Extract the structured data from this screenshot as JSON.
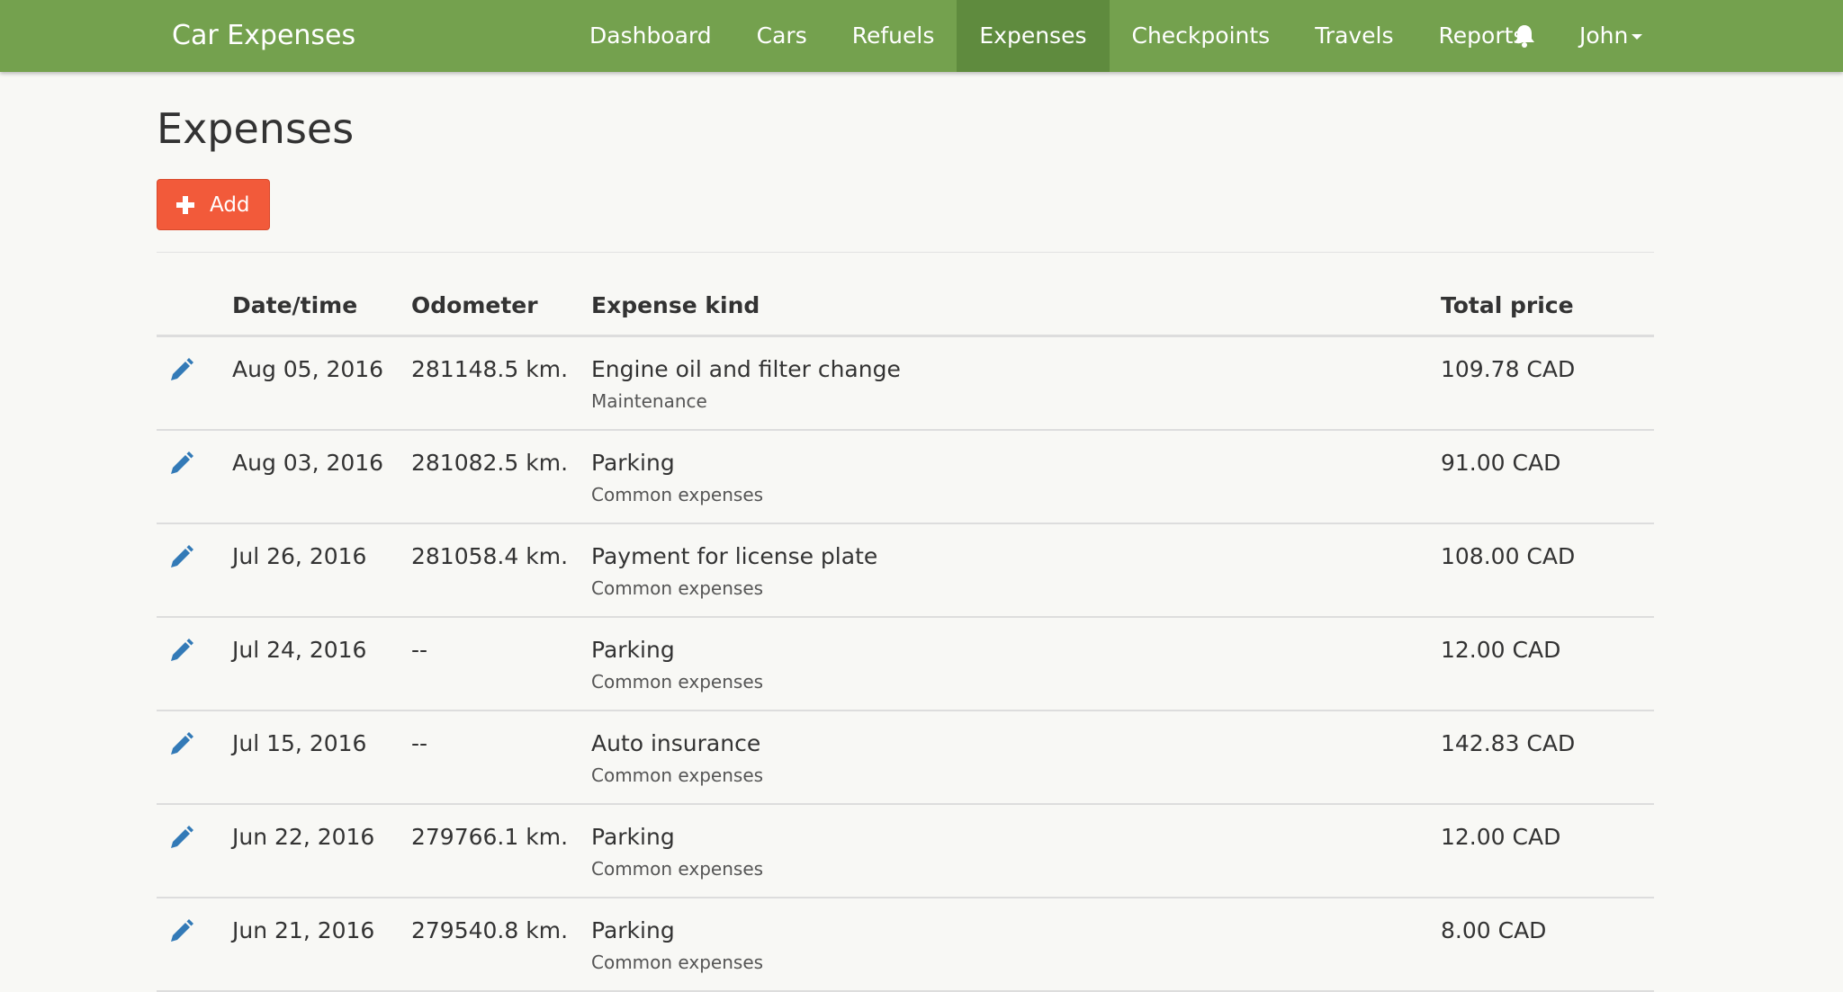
{
  "app": {
    "brand": "Car Expenses"
  },
  "nav": {
    "items": [
      {
        "label": "Dashboard",
        "active": false
      },
      {
        "label": "Cars",
        "active": false
      },
      {
        "label": "Refuels",
        "active": false
      },
      {
        "label": "Expenses",
        "active": true
      },
      {
        "label": "Checkpoints",
        "active": false
      },
      {
        "label": "Travels",
        "active": false
      },
      {
        "label": "Reports",
        "active": false
      }
    ],
    "notifications_icon": "bell-icon",
    "user": "John"
  },
  "page": {
    "title": "Expenses",
    "add_label": "Add"
  },
  "table": {
    "headers": {
      "date": "Date/time",
      "odometer": "Odometer",
      "kind": "Expense kind",
      "total": "Total price"
    },
    "rows": [
      {
        "date": "Aug 05, 2016",
        "odometer": "281148.5 km.",
        "kind": "Engine oil and filter change",
        "category": "Maintenance",
        "total": "109.78 CAD"
      },
      {
        "date": "Aug 03, 2016",
        "odometer": "281082.5 km.",
        "kind": "Parking",
        "category": "Common expenses",
        "total": "91.00 CAD"
      },
      {
        "date": "Jul 26, 2016",
        "odometer": "281058.4 km.",
        "kind": "Payment for license plate",
        "category": "Common expenses",
        "total": "108.00 CAD"
      },
      {
        "date": "Jul 24, 2016",
        "odometer": "--",
        "kind": "Parking",
        "category": "Common expenses",
        "total": "12.00 CAD"
      },
      {
        "date": "Jul 15, 2016",
        "odometer": "--",
        "kind": "Auto insurance",
        "category": "Common expenses",
        "total": "142.83 CAD"
      },
      {
        "date": "Jun 22, 2016",
        "odometer": "279766.1 km.",
        "kind": "Parking",
        "category": "Common expenses",
        "total": "12.00 CAD"
      },
      {
        "date": "Jun 21, 2016",
        "odometer": "279540.8 km.",
        "kind": "Parking",
        "category": "Common expenses",
        "total": "8.00 CAD"
      }
    ]
  },
  "colors": {
    "navbar": "#74a14e",
    "navbar_active": "#5f8b3e",
    "add_button": "#f25a3a",
    "edit_icon": "#337ab7"
  }
}
